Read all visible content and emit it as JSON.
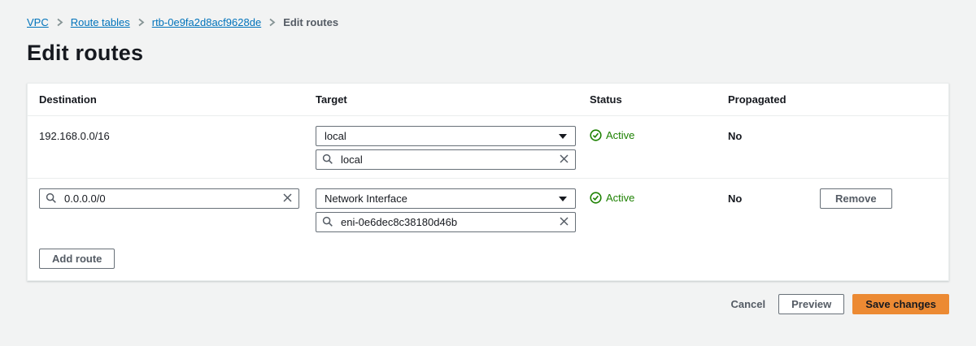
{
  "breadcrumb": {
    "items": [
      {
        "label": "VPC",
        "link": true
      },
      {
        "label": "Route tables",
        "link": true
      },
      {
        "label": "rtb-0e9fa2d8acf9628de",
        "link": true
      },
      {
        "label": "Edit routes",
        "link": false
      }
    ]
  },
  "page": {
    "title": "Edit routes"
  },
  "table": {
    "headers": {
      "destination": "Destination",
      "target": "Target",
      "status": "Status",
      "propagated": "Propagated"
    },
    "rows": [
      {
        "destination": {
          "type": "text",
          "value": "192.168.0.0/16"
        },
        "target": {
          "dropdown": "local",
          "search": "local"
        },
        "status": "Active",
        "propagated": "No"
      },
      {
        "destination": {
          "type": "search",
          "value": "0.0.0.0/0"
        },
        "target": {
          "dropdown": "Network Interface",
          "search": "eni-0e6dec8c38180d46b"
        },
        "status": "Active",
        "propagated": "No",
        "remove_label": "Remove"
      }
    ],
    "add_route_label": "Add route"
  },
  "footer": {
    "cancel_label": "Cancel",
    "preview_label": "Preview",
    "save_label": "Save changes"
  },
  "icons": {
    "search": "magnifier",
    "clear": "x-mark",
    "status_ok": "check-circle",
    "select_caret": "triangle-down",
    "breadcrumb_separator": "chevron-right"
  },
  "colors": {
    "link": "#0073bb",
    "success": "#1d8102",
    "primary_button": "#ec8a33",
    "text": "#16191f",
    "secondary_text": "#545b64",
    "input_border": "#687078",
    "divider": "#eaeded",
    "page_background": "#f2f3f3",
    "panel_background": "#ffffff"
  }
}
